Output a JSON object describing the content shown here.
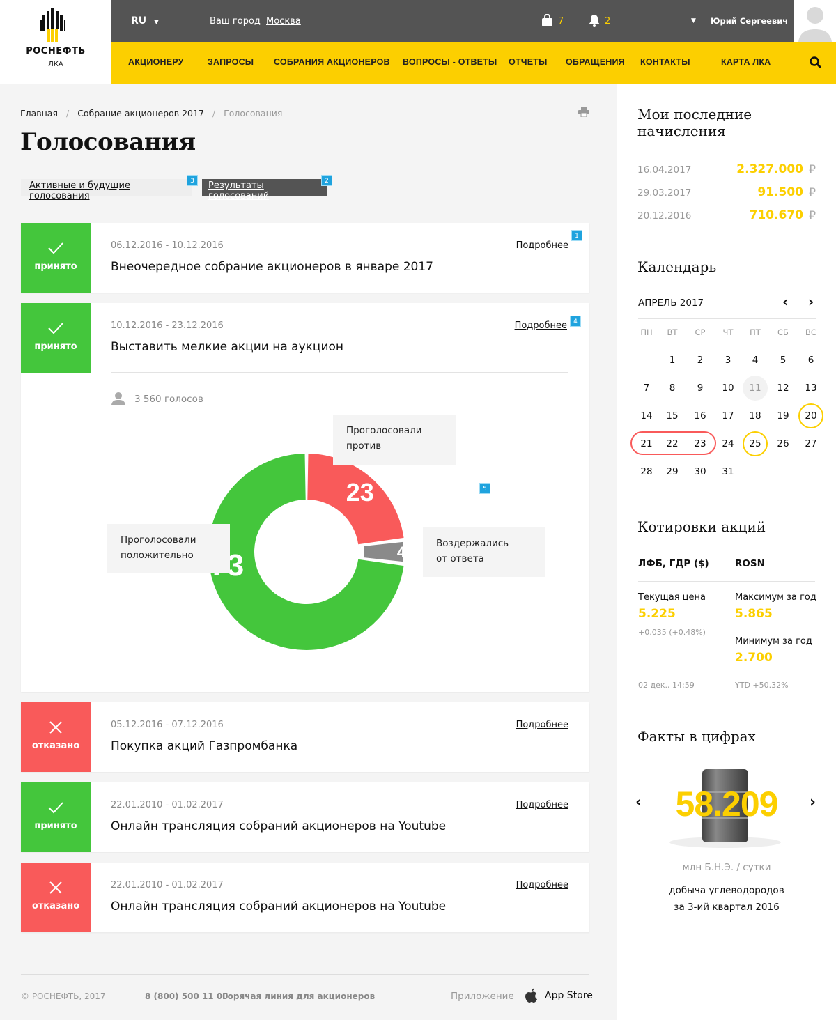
{
  "header": {
    "logo_name": "РОСНЕФТЬ",
    "logo_sub": "ЛКА",
    "lang": "RU",
    "city_label": "Ваш город",
    "city": "Москва",
    "cart_count": "7",
    "notif_count": "2",
    "user_name": "Юрий Сергеевич"
  },
  "nav": [
    "АКЦИОНЕРУ",
    "ЗАПРОСЫ",
    "СОБРАНИЯ АКЦИОНЕРОВ",
    "ВОПРОСЫ - ОТВЕТЫ",
    "ОТЧЕТЫ",
    "ОБРАЩЕНИЯ",
    "КОНТАКТЫ",
    "КАРТА ЛКА"
  ],
  "breadcrumb": [
    "Главная",
    "Собрание акционеров 2017",
    "Голосования"
  ],
  "page_title": "Голосования",
  "tabs": [
    {
      "label": "Активные и будущие голосования",
      "badge": "3"
    },
    {
      "label": "Результаты голосований",
      "badge": "2"
    }
  ],
  "votes": [
    {
      "status": "принято",
      "date": "06.12.2016 - 10.12.2016",
      "title": "Внеочередное собрание акционеров в январе 2017",
      "more": "Подробнее",
      "badge": "1"
    },
    {
      "status": "принято",
      "date": "10.12.2016 - 23.12.2016",
      "title": "Выставить мелкие акции на аукцион",
      "more": "Подробнее",
      "badge": "4",
      "votes_count": "3 560 голосов",
      "result_badge": "5"
    },
    {
      "status": "отказано",
      "date": "05.12.2016 - 07.12.2016",
      "title": "Покупка акций Газпромбанка",
      "more": "Подробнее"
    },
    {
      "status": "принято",
      "date": "22.01.2010 - 01.02.2017",
      "title": "Онлайн трансляция собраний акционеров на Youtube",
      "more": "Подробнее"
    },
    {
      "status": "отказано",
      "date": "22.01.2010 - 01.02.2017",
      "title": "Онлайн трансляция собраний акционеров на Youtube",
      "more": "Подробнее"
    }
  ],
  "chart_data": {
    "type": "pie",
    "donut": true,
    "categories": [
      "Проголосовали против",
      "Воздержались от ответа",
      "Проголосовали положительно"
    ],
    "values": [
      23,
      4,
      73
    ],
    "colors": [
      "#f95a5a",
      "#8a8a8a",
      "#44c63c"
    ]
  },
  "colors": {
    "accent": "#fccf00",
    "accepted": "#44c63c",
    "rejected": "#f95a5a",
    "dark": "#545454",
    "badge": "#1fa3de"
  },
  "accruals": {
    "title": "Мои последние начисления",
    "items": [
      {
        "date": "16.04.2017",
        "amount": "2.327.000",
        "cur": "₽"
      },
      {
        "date": "29.03.2017",
        "amount": "91.500",
        "cur": "₽"
      },
      {
        "date": "20.12.2016",
        "amount": "710.670",
        "cur": "₽"
      }
    ]
  },
  "calendar": {
    "title": "Календарь",
    "month": "АПРЕЛЬ 2017",
    "weekdays": [
      "ПН",
      "ВТ",
      "СР",
      "ЧТ",
      "ПТ",
      "СБ",
      "ВС"
    ],
    "first_weekday": 1,
    "days": 31,
    "today": 11,
    "marked_yellow": [
      20,
      25
    ],
    "range_red": [
      21,
      23
    ]
  },
  "quotes": {
    "title": "Котировки акций",
    "col1": "ЛФБ, ГДР ($)",
    "col2": "ROSN",
    "cur_label": "Текущая цена",
    "cur": "5.225",
    "change": "+0.035 (+0.48%)",
    "max_label": "Максимум за год",
    "max": "5.865",
    "min_label": "Минимум за год",
    "min": "2.700",
    "time": "02 дек., 14:59",
    "ytd": "YTD +50.32%"
  },
  "facts": {
    "title": "Факты в цифрах",
    "value": "58.209",
    "unit": "млн Б.Н.Э. / сутки",
    "desc1": "добыча углеводородов",
    "desc2": "за 3-ий квартал 2016"
  },
  "footer": {
    "copyright": "©  РОСНЕФТЬ, 2017",
    "phone": "8 (800) 500 11 00",
    "hotline": "Горячая линия для акционеров",
    "app_label": "Приложение",
    "app_store": "App Store"
  }
}
